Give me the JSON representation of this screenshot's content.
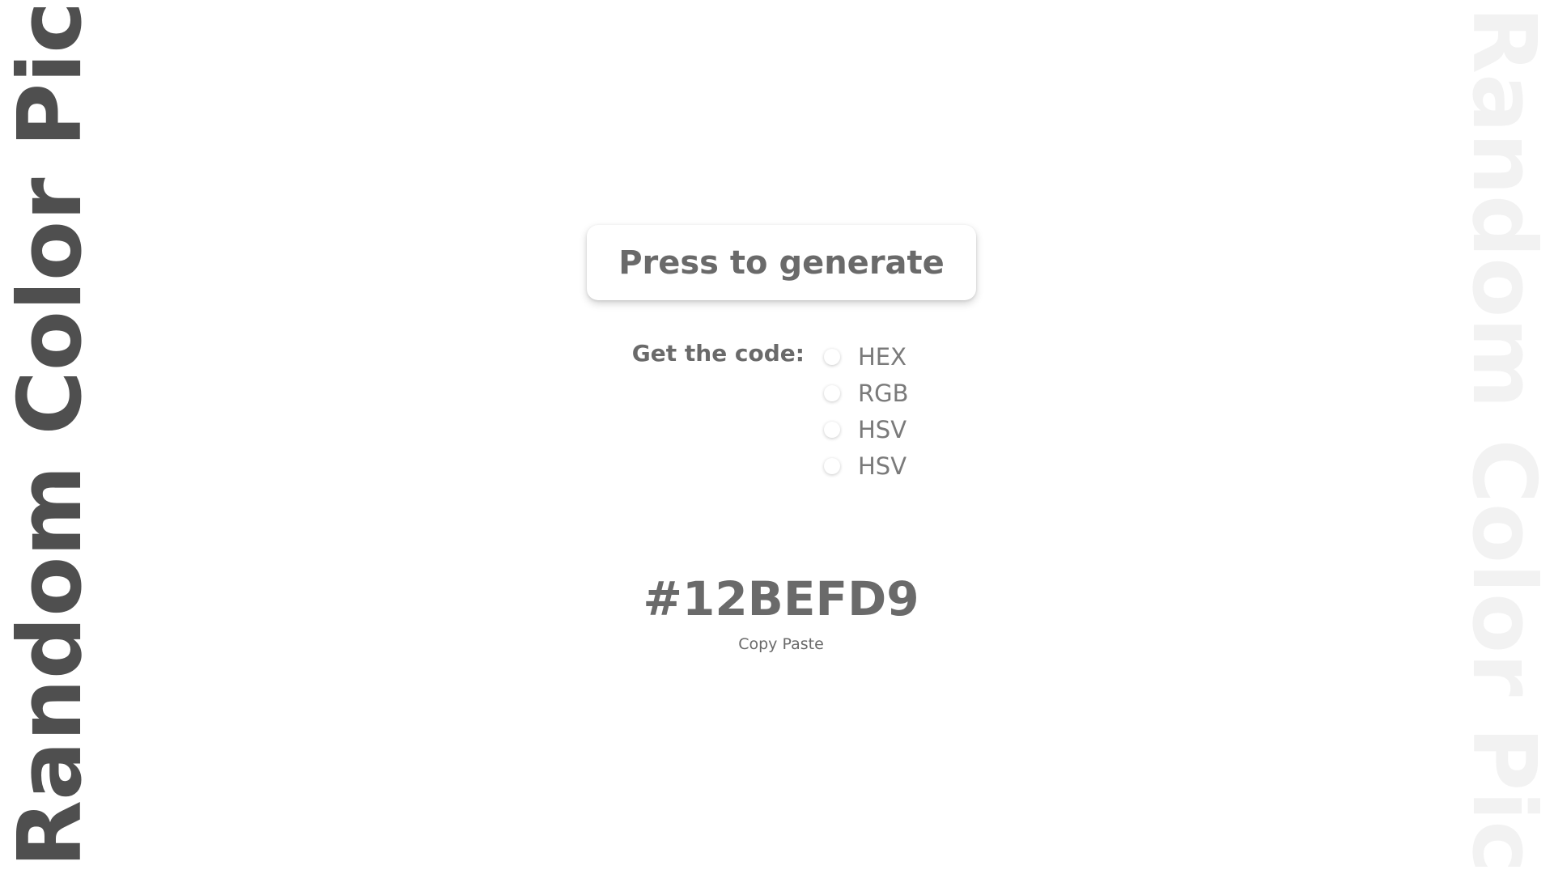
{
  "sidebar_title": "Random Color Picker",
  "generate_button_label": "Press to generate",
  "code_section": {
    "label": "Get the code:",
    "options": [
      {
        "label": "HEX"
      },
      {
        "label": "RGB"
      },
      {
        "label": "HSV"
      },
      {
        "label": "HSV"
      }
    ]
  },
  "result": {
    "color_code": "#12BEFD9",
    "copy_label": "Copy Paste"
  },
  "colors": {
    "text": "#6a6a6a",
    "title_left": "#4f4f4f",
    "title_right": "#f2f2f2",
    "background": "#ffffff"
  }
}
